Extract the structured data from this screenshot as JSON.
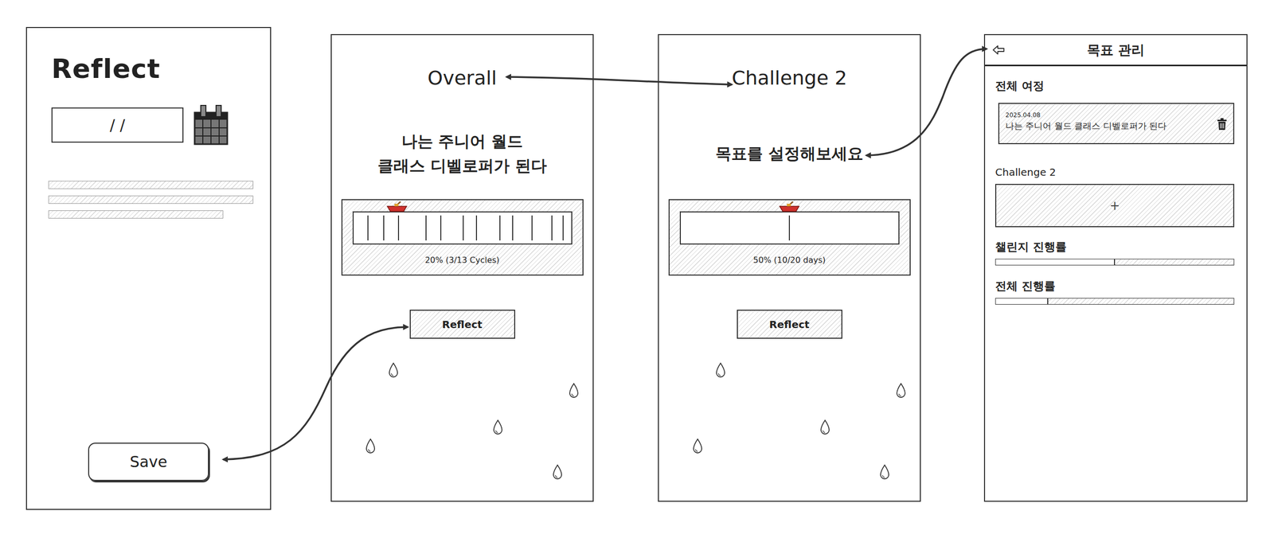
{
  "reflect_screen": {
    "title": "Reflect",
    "date_field": {
      "value": "/ /"
    },
    "save_button": "Save"
  },
  "overall_screen": {
    "tab": "Overall",
    "goal": [
      "나는 주니어 월드",
      "클래스 디벨로퍼가 된다"
    ],
    "progress": {
      "level": 0.2,
      "reading": "20% (3/13 Cycles)",
      "segments": [
        19,
        20,
        19,
        36,
        19,
        29,
        17,
        30,
        16,
        25,
        26,
        14,
        10
      ]
    },
    "reflect_button": "Reflect"
  },
  "challenge_screen": {
    "tab": "Challenge 2",
    "goal": [
      "목표를 설정해보세요"
    ],
    "progress": {
      "level": 0.5,
      "reading": "50% (10/20 days)",
      "segments": [
        10,
        10
      ]
    },
    "reflect_button": "Reflect"
  },
  "manage_screen": {
    "title": "목표 관리",
    "journey": {
      "heading": "전체 여정",
      "date": "2025.04.08",
      "text": "나는 주니어 월드 클래스 디벨로퍼가 된다"
    },
    "challenge": {
      "heading": "Challenge 2",
      "add": "+"
    },
    "bars": [
      {
        "label": "챌린지 진행률",
        "level": 0.5
      },
      {
        "label": "전체 진행률",
        "level": 0.22
      }
    ]
  }
}
